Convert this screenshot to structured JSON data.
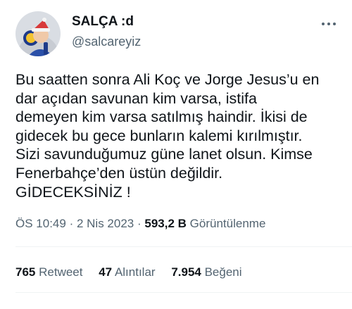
{
  "author": {
    "display_name": "SALÇA :d",
    "handle": "@salcareyiz",
    "avatar_icon": "profile-avatar-icon"
  },
  "menu": {
    "more_icon": "more-dots-icon"
  },
  "tweet": {
    "lines": [
      "Bu saatten sonra Ali Koç ve Jorge Jesus’u en",
      "dar açıdan savunan kim varsa, istifa",
      "demeyen kim varsa satılmış haindir. İkisi de",
      "gidecek bu gece bunların kalemi kırılmıştır.",
      "Sizi savunduğumuz güne lanet olsun. Kimse",
      "Fenerbahçe’den üstün değildir.",
      "GİDECEKSİNİZ !"
    ]
  },
  "meta": {
    "time": "ÖS 10:49",
    "separator": "·",
    "date": "2 Nis 2023",
    "views_count": "593,2 B",
    "views_label": "Görüntülenme"
  },
  "stats": {
    "retweets_count": "765",
    "retweets_label": "Retweet",
    "quotes_count": "47",
    "quotes_label": "Alıntılar",
    "likes_count": "7.954",
    "likes_label": "Beğeni"
  },
  "colors": {
    "text": "#0f1419",
    "secondary": "#536471",
    "divider": "#eff3f4"
  }
}
